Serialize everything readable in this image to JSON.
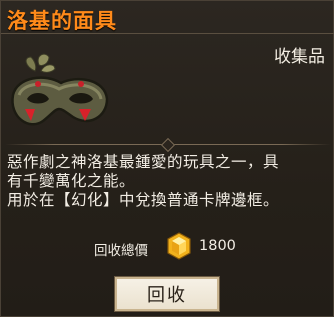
{
  "item": {
    "name": "洛基的面具",
    "category": "收集品",
    "icon": "masquerade-mask-icon",
    "description_lines": [
      "惡作劇之神洛基最鍾愛的玩具之一，具",
      "有千變萬化之能。",
      "用於在【幻化】中兌換普通卡牌邊框。"
    ]
  },
  "recycle": {
    "label": "回收總價",
    "currency_icon": "gold-gem-icon",
    "amount": "1800",
    "button_label": "回收"
  },
  "colors": {
    "title": "#ff8a1a",
    "text": "#f2ede4",
    "background": "#2a2520"
  }
}
